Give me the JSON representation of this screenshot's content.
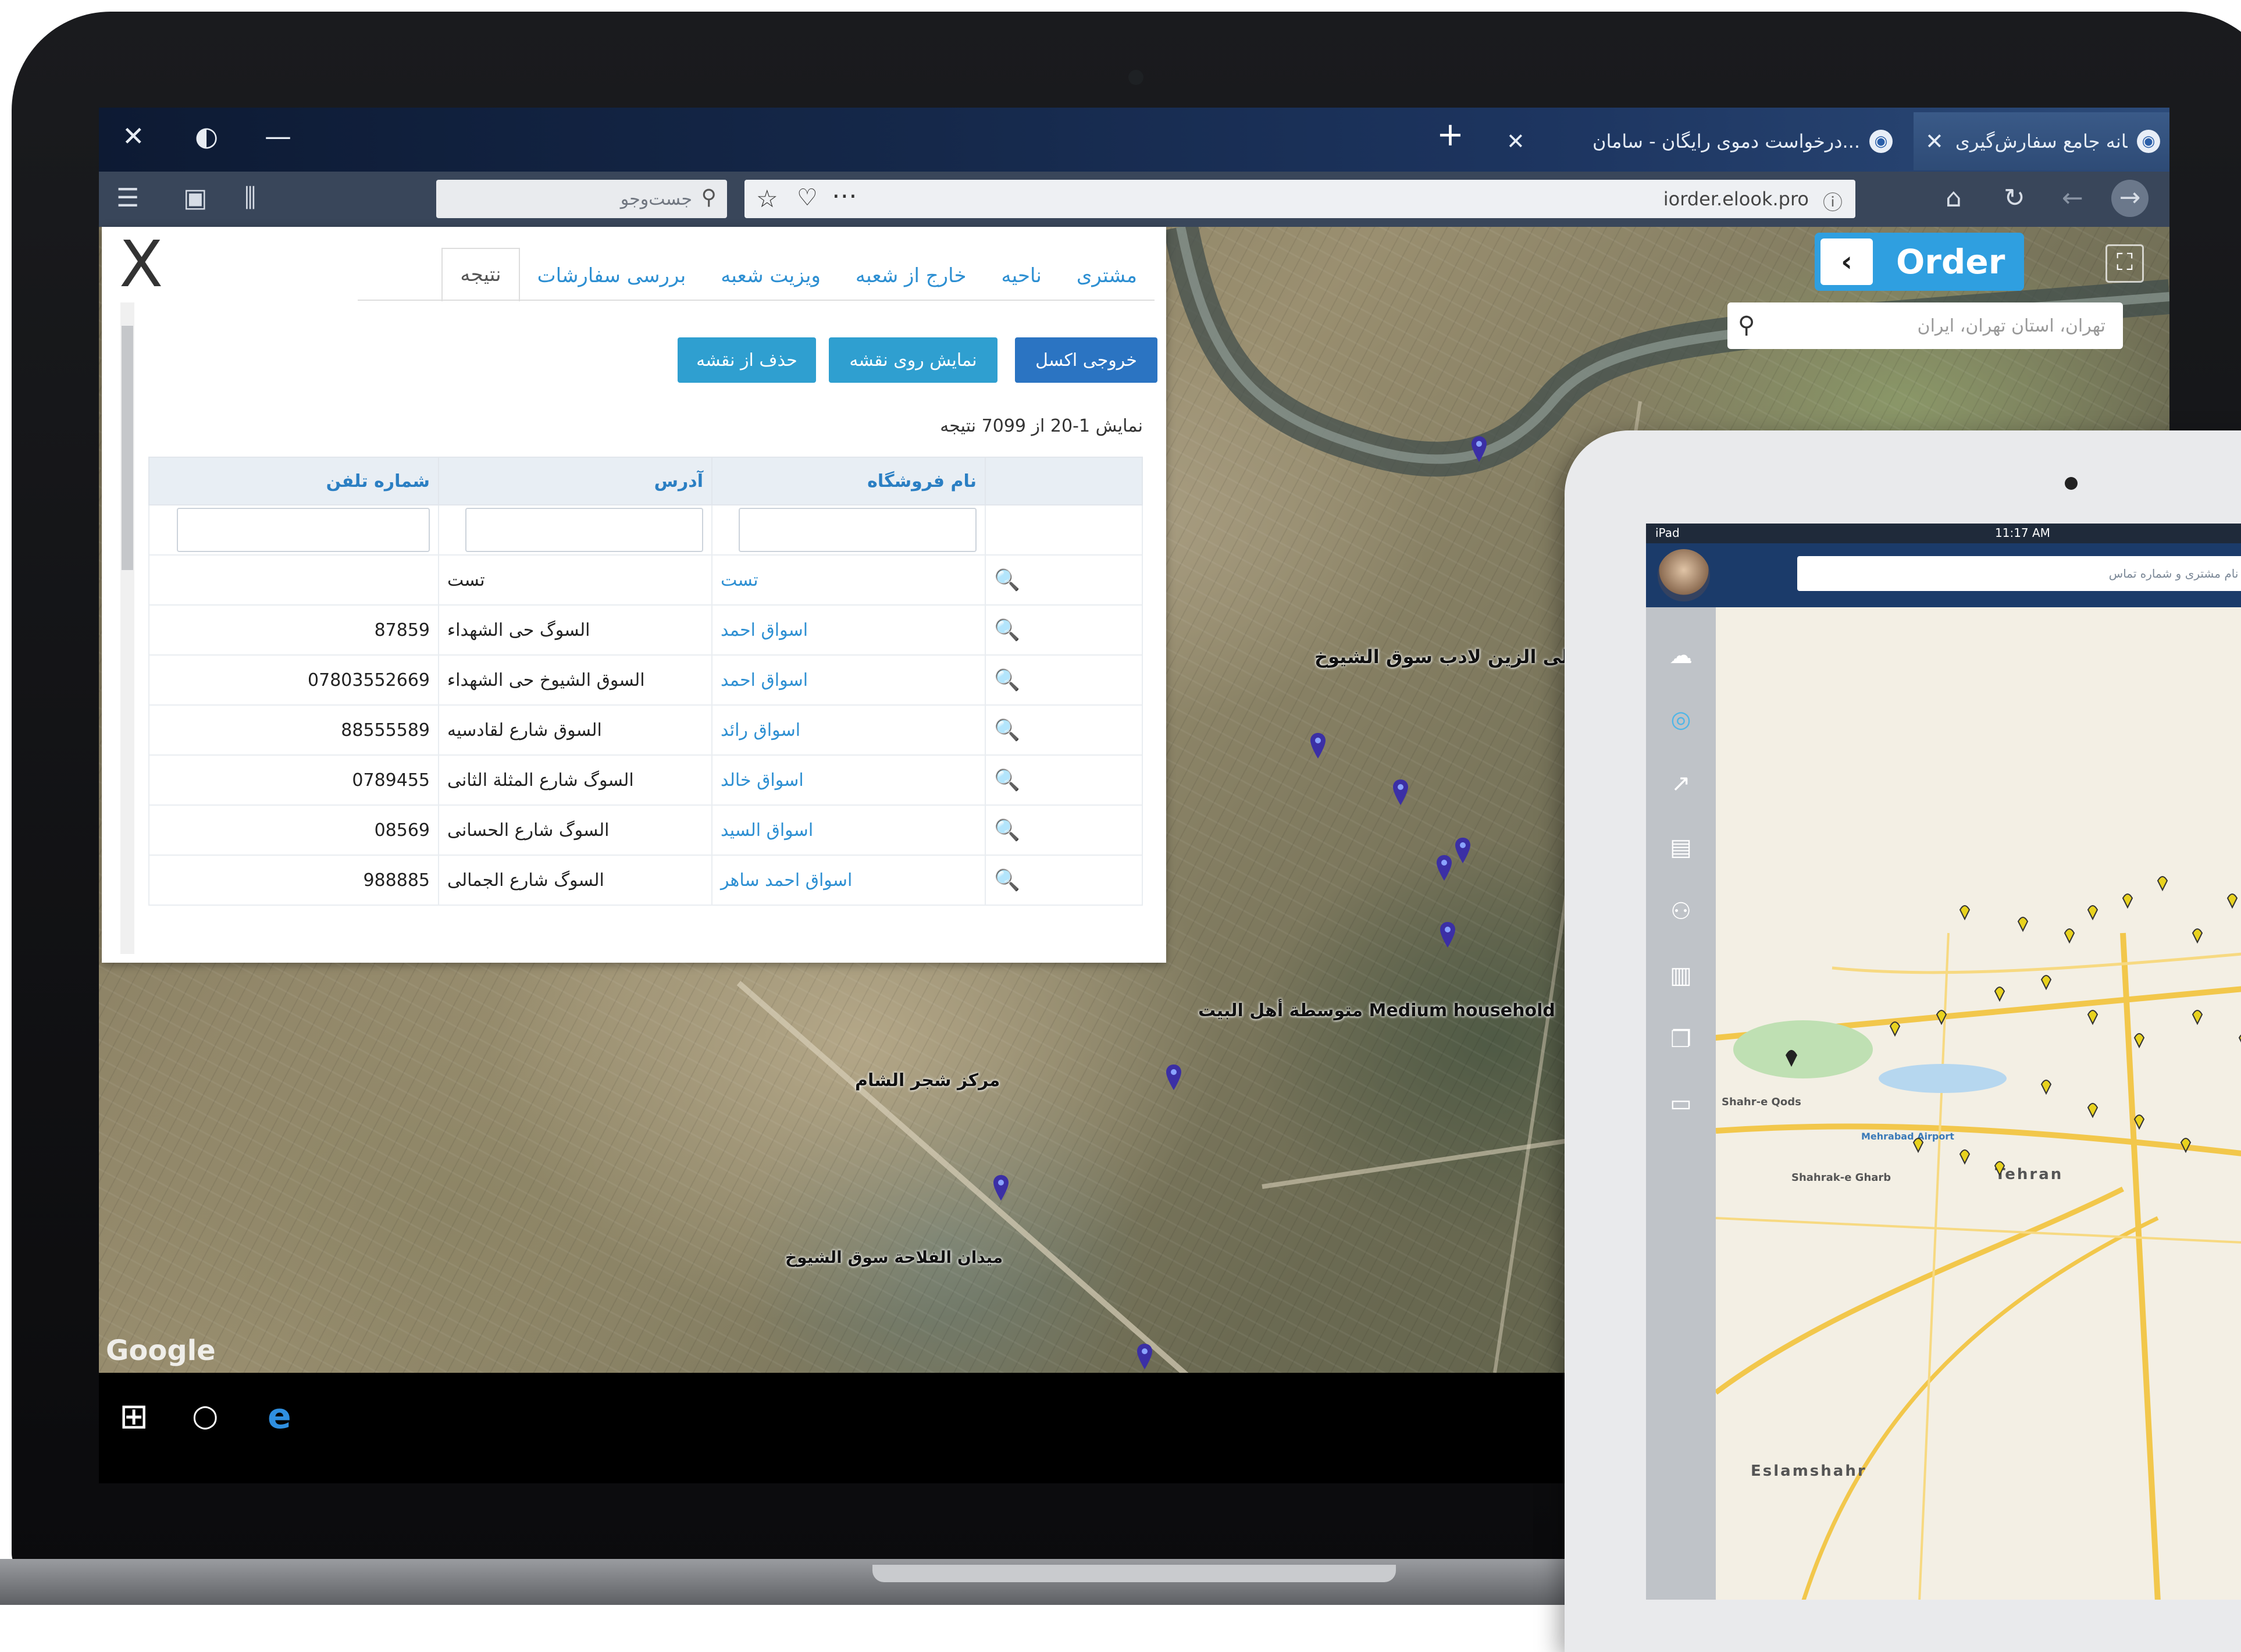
{
  "browser": {
    "window_controls": [
      "✕",
      "◐",
      "—"
    ],
    "tabs": [
      {
        "title": "سامانه جامع سفارش‌گیری | ...",
        "active": true
      },
      {
        "title": "درخواست دموی رایگان - سامان...",
        "active": false
      }
    ],
    "new_tab": "+",
    "search_placeholder": "جست‌وجو",
    "url": "iorder.elook.pro"
  },
  "map": {
    "order_logo": "Order",
    "search_placeholder": "تهران، استان تهران، ایران",
    "labels": [
      "مصلی الزین لادب سوق الشیوخ",
      "متوسطة أهل البيت Medium household",
      "مركز شجر الشام",
      "ميدان الفلاحة سوق الشيوخ"
    ],
    "attribution": "Google"
  },
  "panel": {
    "close_label": "X",
    "tabs": [
      "مشتری",
      "ناحیه",
      "خارج از شعبه",
      "ویزیت شعبه",
      "بررسی سفارشات",
      "نتیجه"
    ],
    "active_tab": "نتیجه",
    "buttons": {
      "export_excel": "خروجی اکسل",
      "show_on_map": "نمایش روی نقشه",
      "remove_from_map": "حذف از نقشه"
    },
    "result_info": "نمایش 1-20 از 7099 نتیجه",
    "columns": [
      "نام فروشگاه",
      "آدرس",
      "شماره تلفن"
    ],
    "rows": [
      {
        "name": "تست",
        "address": "تست",
        "phone": ""
      },
      {
        "name": "اسواق احمد",
        "address": "السوگ حی الشهداء",
        "phone": "87859"
      },
      {
        "name": "اسواق احمد",
        "address": "السوق الشیوخ حی الشهداء",
        "phone": "07803552669"
      },
      {
        "name": "اسواق رائد",
        "address": "السوق شارع لقادسیه",
        "phone": "88555589"
      },
      {
        "name": "اسواق خالد",
        "address": "السوگ شارع المثلة الثانی",
        "phone": "0789455"
      },
      {
        "name": "اسواق السید",
        "address": "السوگ شارع الحسانی",
        "phone": "08569"
      },
      {
        "name": "اسواق احمد ساهر",
        "address": "السوگ شارع الجمالی",
        "phone": "988885"
      }
    ]
  },
  "tablet": {
    "status_left": "iPad",
    "status_time": "11:17 AM",
    "search_placeholder": "جستجو براساس نام مشتری و شماره تماس",
    "city_labels": [
      "Tehran",
      "Eslamshahr",
      "Shahr-e Qods",
      "Shahrak-e Gharb",
      "Mehrabad Airport"
    ],
    "pin_color": "#e8d21e"
  },
  "colors": {
    "accent_button": "#2f9fd0",
    "export_button": "#2b74c2",
    "link_blue": "#2d8fd2",
    "order_blue": "#2f9fe0"
  }
}
